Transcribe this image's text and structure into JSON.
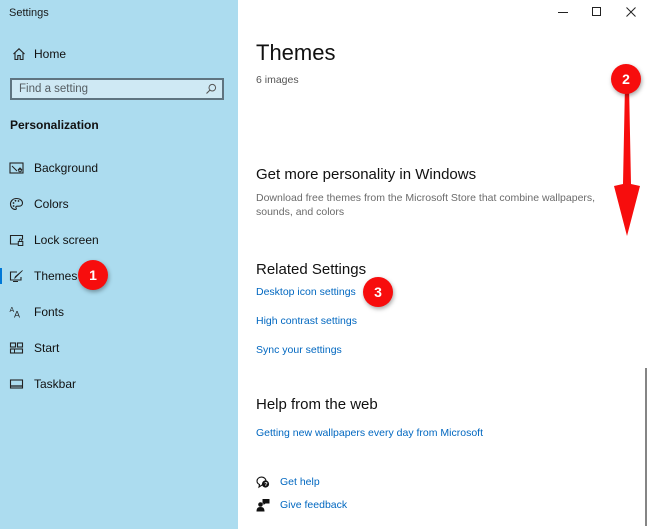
{
  "window": {
    "title": "Settings",
    "controls": {
      "minimize": "minimize-icon",
      "maximize": "maximize-icon",
      "close": "close-icon"
    }
  },
  "sidebar": {
    "home_label": "Home",
    "search": {
      "placeholder": "Find a setting",
      "value": ""
    },
    "section_title": "Personalization",
    "items": [
      {
        "label": "Background",
        "icon": "background-icon"
      },
      {
        "label": "Colors",
        "icon": "palette-icon"
      },
      {
        "label": "Lock screen",
        "icon": "lock-screen-icon"
      },
      {
        "label": "Themes",
        "icon": "themes-icon",
        "selected": true
      },
      {
        "label": "Fonts",
        "icon": "fonts-icon"
      },
      {
        "label": "Start",
        "icon": "start-icon"
      },
      {
        "label": "Taskbar",
        "icon": "taskbar-icon"
      }
    ]
  },
  "main": {
    "title": "Themes",
    "image_count": "6 images",
    "personality": {
      "heading": "Get more personality in Windows",
      "description": "Download free themes from the Microsoft Store that combine wallpapers, sounds, and colors"
    },
    "related": {
      "heading": "Related Settings",
      "links": [
        "Desktop icon settings",
        "High contrast settings",
        "Sync your settings"
      ]
    },
    "help_web": {
      "heading": "Help from the web",
      "links": [
        "Getting new wallpapers every day from Microsoft"
      ]
    },
    "support": {
      "get_help": "Get help",
      "give_feedback": "Give feedback"
    }
  },
  "annotations": {
    "badge_1": "1",
    "badge_2": "2",
    "badge_3": "3",
    "color": "#f70d0d"
  }
}
